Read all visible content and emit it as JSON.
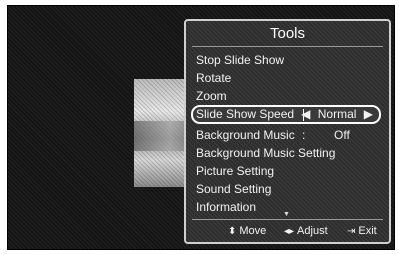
{
  "panel": {
    "title": "Tools",
    "items": [
      {
        "label": "Stop Slide Show"
      },
      {
        "label": "Rotate"
      },
      {
        "label": "Zoom"
      },
      {
        "label": "Slide Show Speed",
        "value": "Normal",
        "selected": true
      },
      {
        "label": "Background Music",
        "value": "Off"
      },
      {
        "label": "Background Music Setting"
      },
      {
        "label": "Picture Setting"
      },
      {
        "label": "Sound Setting"
      },
      {
        "label": "Information"
      }
    ]
  },
  "footer": {
    "move": "Move",
    "adjust": "Adjust",
    "exit": "Exit"
  },
  "icons": {
    "move": "up-down-arrow-icon",
    "adjust": "left-right-arrow-icon",
    "exit": "exit-icon",
    "more": "scroll-down-arrow-icon"
  }
}
